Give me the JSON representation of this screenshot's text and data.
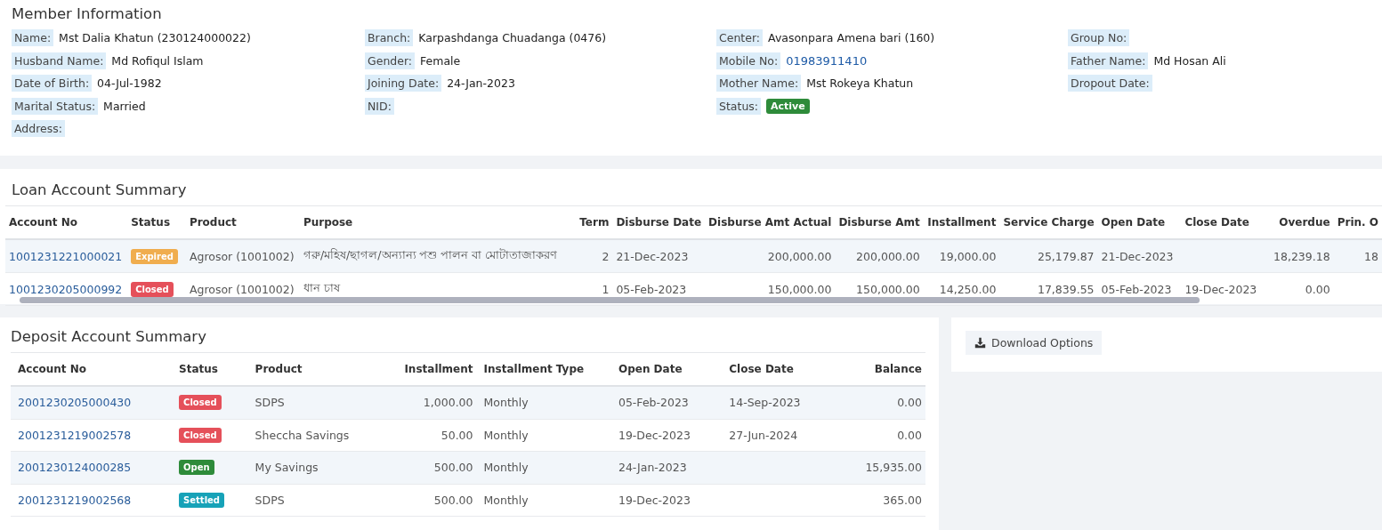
{
  "member_info": {
    "title": "Member Information",
    "columns": [
      [
        {
          "label": "Name:",
          "value": "Mst Dalia Khatun (230124000022)"
        },
        {
          "label": "Husband Name:",
          "value": "Md Rofiqul Islam"
        },
        {
          "label": "Date of Birth:",
          "value": "04-Jul-1982"
        },
        {
          "label": "Marital Status:",
          "value": "Married"
        },
        {
          "label": "Address:"
        }
      ],
      [
        {
          "label": "Branch:",
          "value": "Karpashdanga Chuadanga (0476)"
        },
        {
          "label": "Gender:",
          "value": "Female"
        },
        {
          "label": "Joining Date:",
          "value": "24-Jan-2023"
        },
        {
          "label": "NID:"
        }
      ],
      [
        {
          "label": "Center:",
          "value": "Avasonpara Amena bari (160)"
        },
        {
          "label": "Mobile No:",
          "value": "01983911410",
          "kind": "link"
        },
        {
          "label": "Mother Name:",
          "value": "Mst Rokeya Khatun"
        },
        {
          "label": "Status:",
          "value": "Active",
          "kind": "badge",
          "color": "#2e8b3a"
        }
      ],
      [
        {
          "label": "Group No:"
        },
        {
          "label": "Father Name:",
          "value": "Md Hosan Ali"
        },
        {
          "label": "Dropout Date:"
        }
      ]
    ]
  },
  "loan_summary": {
    "title": "Loan Account Summary",
    "columns": [
      {
        "label": "Account No",
        "kind": "link"
      },
      {
        "label": "Status",
        "kind": "status"
      },
      {
        "label": "Product",
        "kind": "text"
      },
      {
        "label": "Purpose",
        "kind": "text"
      },
      {
        "label": "Term",
        "kind": "num"
      },
      {
        "label": "Disburse Date",
        "kind": "text"
      },
      {
        "label": "Disburse Amt Actual",
        "kind": "num"
      },
      {
        "label": "Disburse Amt",
        "kind": "num"
      },
      {
        "label": "Installment",
        "kind": "num"
      },
      {
        "label": "Service Charge",
        "kind": "num"
      },
      {
        "label": "Open Date",
        "kind": "text"
      },
      {
        "label": "Close Date",
        "kind": "text"
      },
      {
        "label": "Overdue",
        "kind": "num"
      },
      {
        "label": "Prin. O",
        "kind": "num"
      }
    ],
    "rows": [
      {
        "cells": [
          "1001231221000021",
          {
            "label": "Expired",
            "color": "#f0ad4e"
          },
          "Agrosor (1001002)",
          "গরু/মহিষ/ছাগল/অন্যান্য পশু পালন বা মোটাতাজাকরণ",
          "2",
          "21-Dec-2023",
          "200,000.00",
          "200,000.00",
          "19,000.00",
          "25,179.87",
          "21-Dec-2023",
          null,
          "18,239.18",
          "18"
        ]
      },
      {
        "cells": [
          "1001230205000992",
          {
            "label": "Closed",
            "color": "#e5505a"
          },
          "Agrosor (1001002)",
          "ধান চাষ",
          "1",
          "05-Feb-2023",
          "150,000.00",
          "150,000.00",
          "14,250.00",
          "17,839.55",
          "05-Feb-2023",
          "19-Dec-2023",
          "0.00",
          null
        ]
      }
    ]
  },
  "deposit_summary": {
    "title": "Deposit Account Summary",
    "columns": [
      {
        "label": "Account No",
        "kind": "link"
      },
      {
        "label": "Status",
        "kind": "status"
      },
      {
        "label": "Product",
        "kind": "text"
      },
      {
        "label": "Installment",
        "kind": "num"
      },
      {
        "label": "Installment Type",
        "kind": "text"
      },
      {
        "label": "Open Date",
        "kind": "text"
      },
      {
        "label": "Close Date",
        "kind": "text"
      },
      {
        "label": "Balance",
        "kind": "num"
      }
    ],
    "rows": [
      {
        "cells": [
          "2001230205000430",
          {
            "label": "Closed",
            "color": "#e5505a"
          },
          "SDPS",
          "1,000.00",
          "Monthly",
          "05-Feb-2023",
          "14-Sep-2023",
          "0.00"
        ]
      },
      {
        "cells": [
          "2001231219002578",
          {
            "label": "Closed",
            "color": "#e5505a"
          },
          "Sheccha Savings",
          "50.00",
          "Monthly",
          "19-Dec-2023",
          "27-Jun-2024",
          "0.00"
        ]
      },
      {
        "cells": [
          "2001230124000285",
          {
            "label": "Open",
            "color": "#2e8b3a"
          },
          "My Savings",
          "500.00",
          "Monthly",
          "24-Jan-2023",
          null,
          "15,935.00"
        ]
      },
      {
        "cells": [
          "2001231219002568",
          {
            "label": "Settled",
            "color": "#17a2b8"
          },
          "SDPS",
          "500.00",
          "Monthly",
          "19-Dec-2023",
          null,
          "365.00"
        ]
      }
    ]
  },
  "download_button": {
    "label": "Download Options"
  }
}
